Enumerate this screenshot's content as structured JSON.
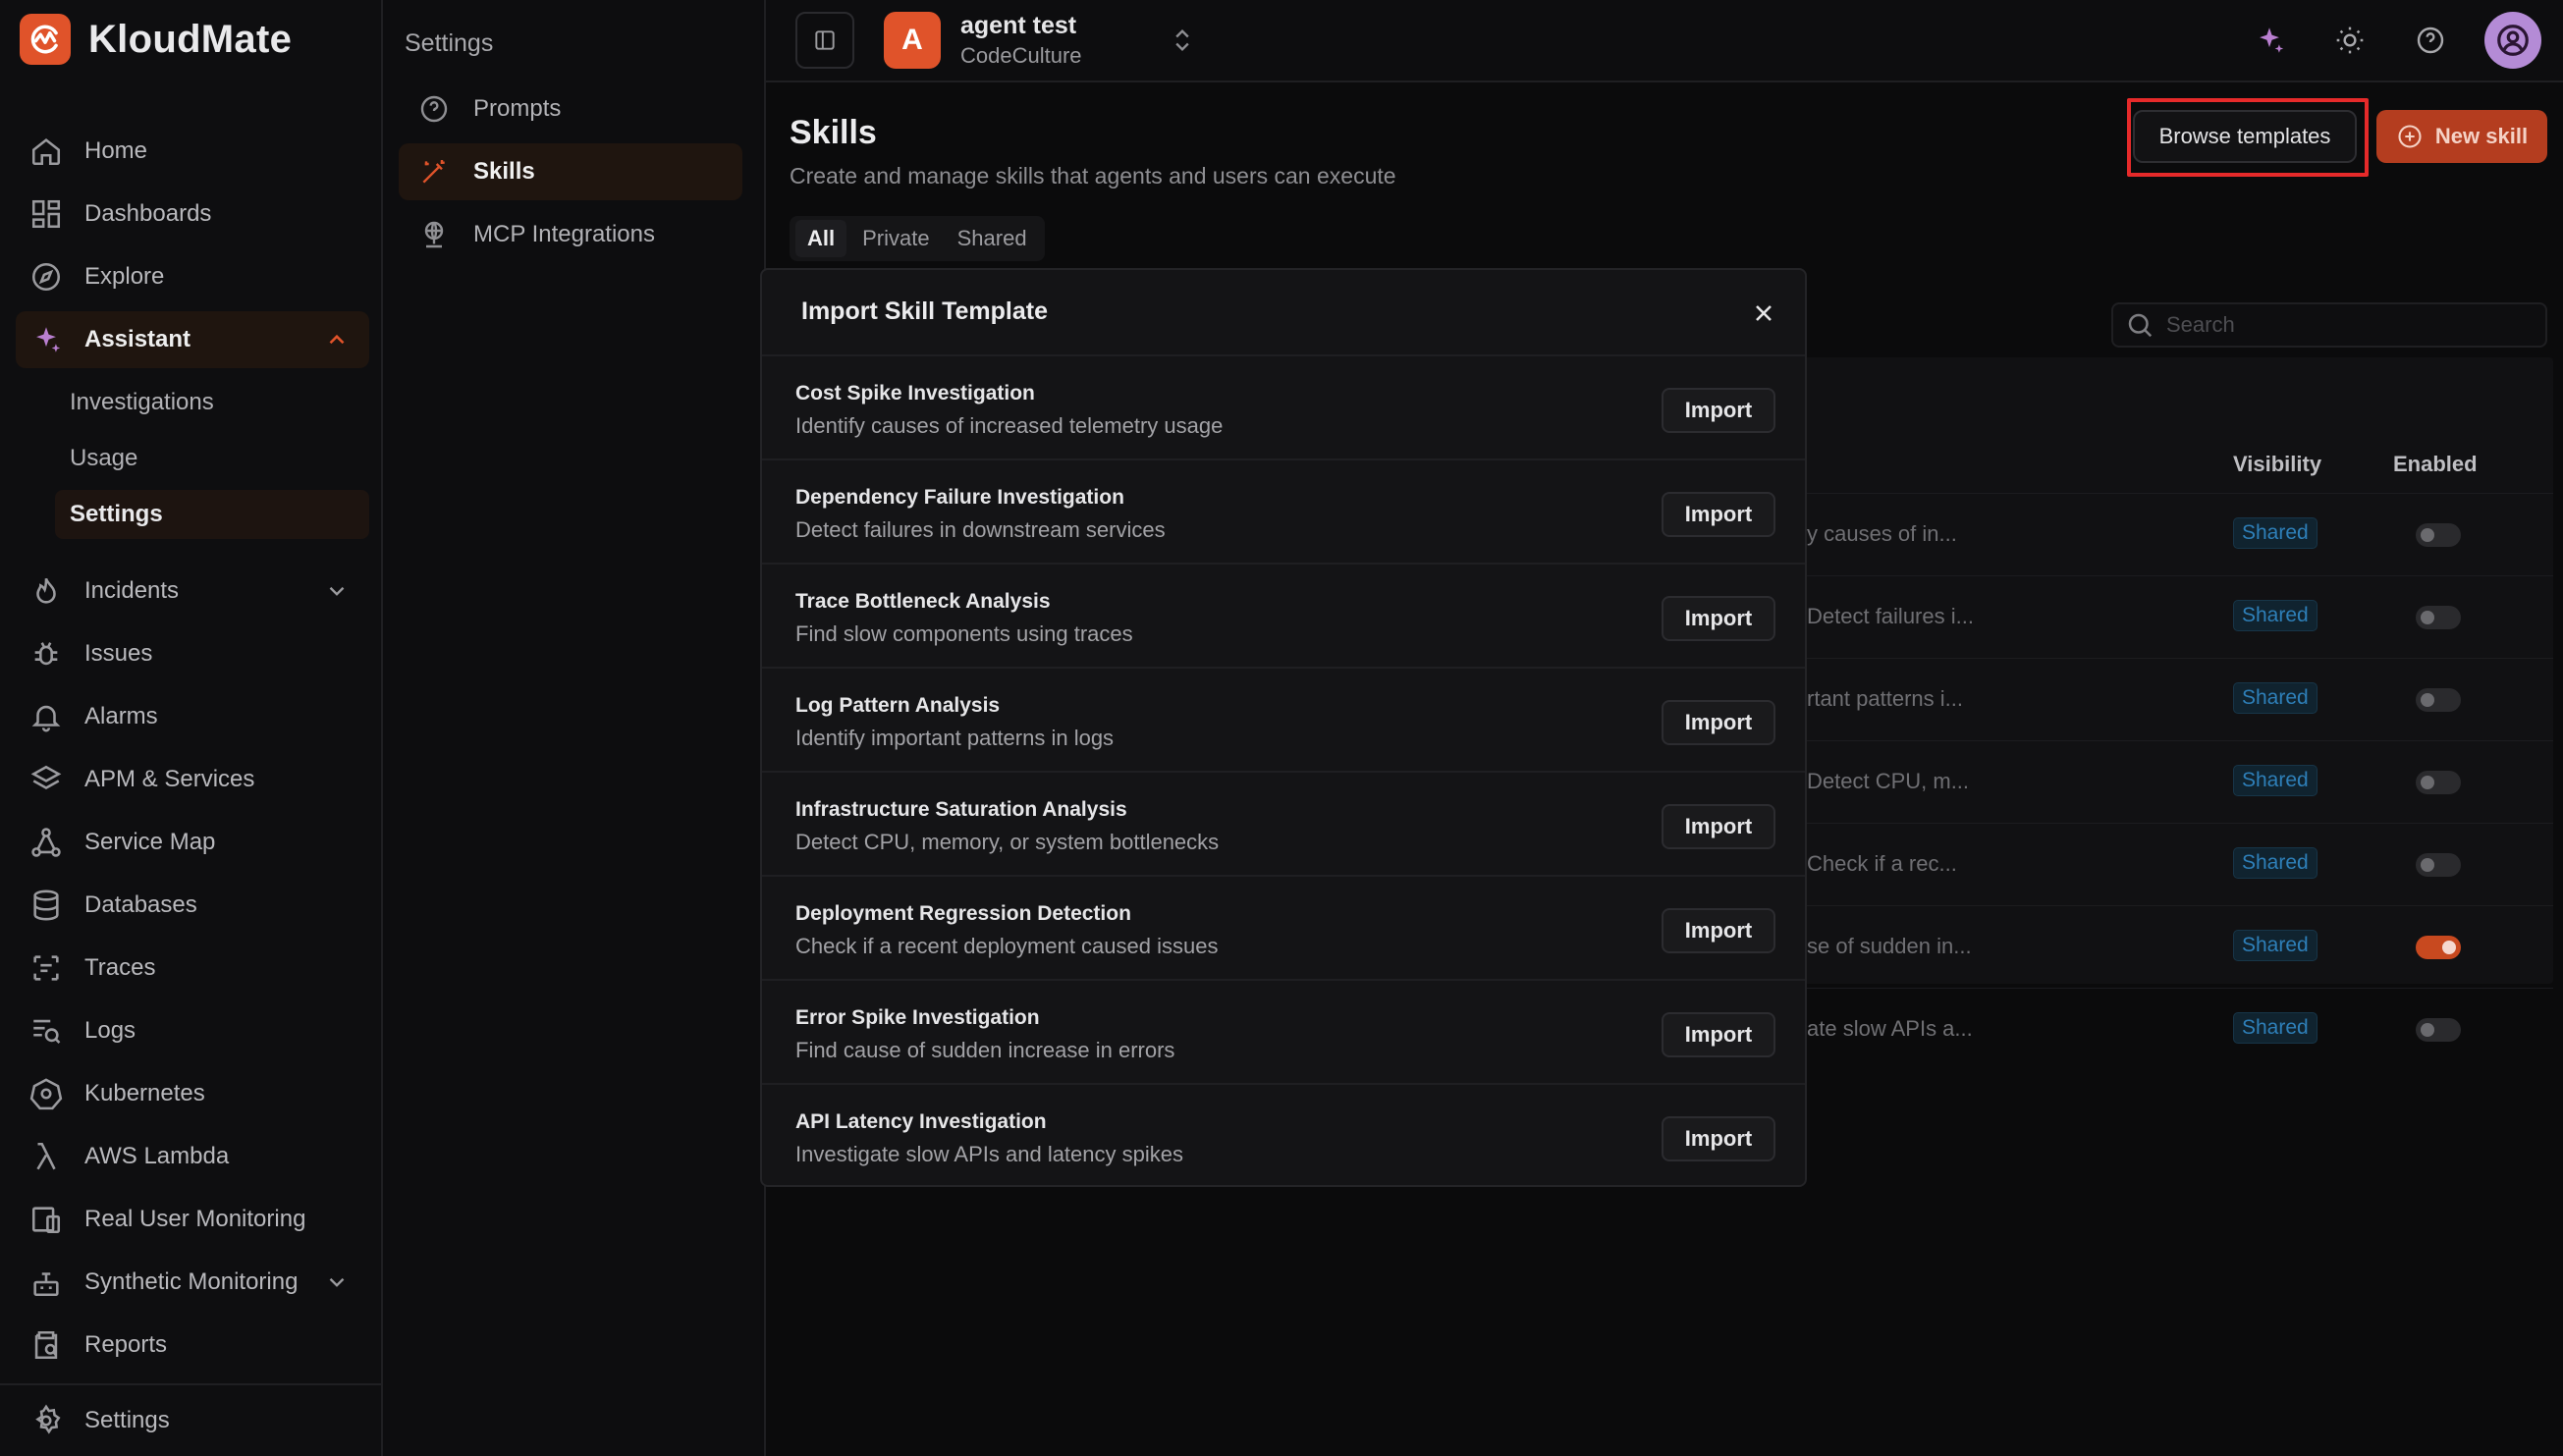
{
  "brand": {
    "name": "KloudMate",
    "accent": "#e0532a"
  },
  "nav": {
    "home": "Home",
    "dashboards": "Dashboards",
    "explore": "Explore",
    "assistant": "Assistant",
    "assistant_sub": {
      "investigations": "Investigations",
      "usage": "Usage",
      "settings": "Settings"
    },
    "incidents": "Incidents",
    "issues": "Issues",
    "alarms": "Alarms",
    "apm": "APM & Services",
    "service_map": "Service Map",
    "databases": "Databases",
    "traces": "Traces",
    "logs": "Logs",
    "kubernetes": "Kubernetes",
    "aws_lambda": "AWS Lambda",
    "rum": "Real User Monitoring",
    "synthetic": "Synthetic Monitoring",
    "reports": "Reports",
    "settings": "Settings"
  },
  "settings_nav": {
    "heading": "Settings",
    "prompts": "Prompts",
    "skills": "Skills",
    "mcp": "MCP Integrations"
  },
  "header": {
    "org_avatar_letter": "A",
    "org_name": "agent test",
    "org_sub": "CodeCulture"
  },
  "page": {
    "title": "Skills",
    "subtitle": "Create and manage skills that agents and users can execute",
    "browse_label": "Browse templates",
    "new_label": "New skill",
    "tabs": {
      "all": "All",
      "private": "Private",
      "shared": "Shared"
    },
    "search_placeholder": "Search"
  },
  "table": {
    "columns": {
      "visibility": "Visibility",
      "enabled": "Enabled"
    },
    "rows": [
      {
        "desc": "y causes of in...",
        "visibility": "Shared",
        "enabled": false
      },
      {
        "desc": "Detect failures i...",
        "visibility": "Shared",
        "enabled": false
      },
      {
        "desc": "rtant patterns i...",
        "visibility": "Shared",
        "enabled": false
      },
      {
        "desc": "Detect CPU, m...",
        "visibility": "Shared",
        "enabled": false
      },
      {
        "desc": "Check if a rec...",
        "visibility": "Shared",
        "enabled": false
      },
      {
        "desc": "se of sudden in...",
        "visibility": "Shared",
        "enabled": true
      },
      {
        "desc": "ate slow APIs a...",
        "visibility": "Shared",
        "enabled": false
      }
    ]
  },
  "modal": {
    "title": "Import Skill Template",
    "import_label": "Import",
    "templates": [
      {
        "name": "Cost Spike Investigation",
        "desc": "Identify causes of increased telemetry usage"
      },
      {
        "name": "Dependency Failure Investigation",
        "desc": "Detect failures in downstream services"
      },
      {
        "name": "Trace Bottleneck Analysis",
        "desc": "Find slow components using traces"
      },
      {
        "name": "Log Pattern Analysis",
        "desc": "Identify important patterns in logs"
      },
      {
        "name": "Infrastructure Saturation Analysis",
        "desc": "Detect CPU, memory, or system bottlenecks"
      },
      {
        "name": "Deployment Regression Detection",
        "desc": "Check if a recent deployment caused issues"
      },
      {
        "name": "Error Spike Investigation",
        "desc": "Find cause of sudden increase in errors"
      },
      {
        "name": "API Latency Investigation",
        "desc": "Investigate slow APIs and latency spikes"
      }
    ]
  }
}
